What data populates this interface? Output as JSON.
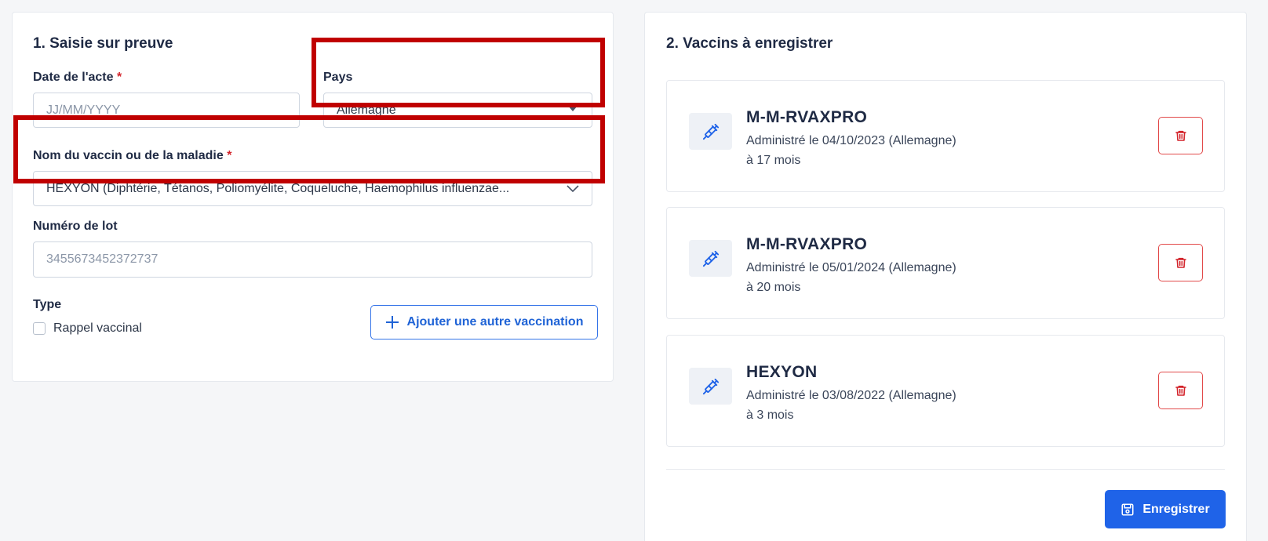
{
  "left_section": {
    "title": "1. Saisie sur preuve",
    "date_label": "Date de l'acte",
    "required_mark": "*",
    "date_placeholder": "JJ/MM/YYYY",
    "country_label": "Pays",
    "country_value": "Allemagne",
    "vaccine_label": "Nom du vaccin ou de la maladie",
    "vaccine_value": "HEXYON (Diphtérie, Tétanos, Poliomyélite, Coqueluche, Haemophilus influenzae...",
    "lot_label": "Numéro de lot",
    "lot_placeholder": "3455673452372737",
    "type_label": "Type",
    "booster_label": "Rappel vaccinal",
    "booster_checked": false,
    "add_button_label": "Ajouter une autre vaccination"
  },
  "right_section": {
    "title": "2. Vaccins à enregistrer",
    "vaccines": [
      {
        "name": "M-M-RVAXPRO",
        "administered": "Administré le 04/10/2023 (Allemagne)",
        "age": "à 17 mois"
      },
      {
        "name": "M-M-RVAXPRO",
        "administered": "Administré le 05/01/2024 (Allemagne)",
        "age": "à 20 mois"
      },
      {
        "name": "HEXYON",
        "administered": "Administré le 03/08/2022 (Allemagne)",
        "age": "à 3 mois"
      }
    ],
    "save_button_label": "Enregistrer"
  },
  "colors": {
    "primary": "#1f63e8",
    "danger": "#e24b4b",
    "highlight_box": "#c00000",
    "required": "#d3242b"
  },
  "icons": [
    "syringe-icon",
    "trash-icon",
    "plus-icon",
    "save-icon",
    "chevron-down-icon",
    "caret-down-icon"
  ]
}
